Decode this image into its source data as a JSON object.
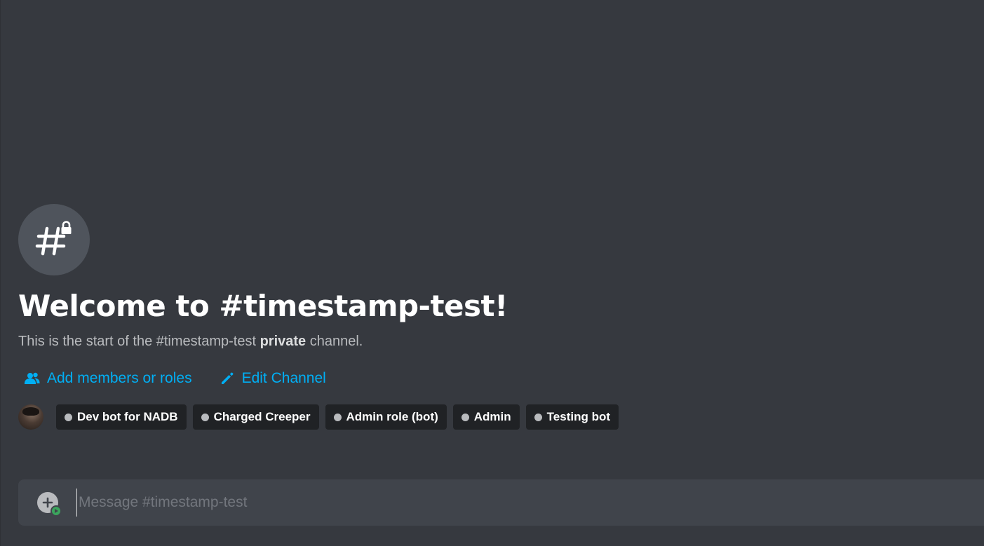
{
  "channel": {
    "name": "timestamp-test",
    "welcome_title": "Welcome to #timestamp-test!",
    "description_prefix": "This is the start of the #timestamp-test ",
    "description_strong": "private",
    "description_suffix": " channel.",
    "icon": "hashtag-lock-icon"
  },
  "actions": [
    {
      "label": "Add members or roles",
      "icon": "members-icon"
    },
    {
      "label": "Edit Channel",
      "icon": "pencil-icon"
    }
  ],
  "members": {
    "avatar": "user-avatar",
    "chips": [
      {
        "label": "Dev bot for NADB",
        "icon": "role-dot"
      },
      {
        "label": "Charged Creeper",
        "icon": "role-dot"
      },
      {
        "label": "Admin role (bot)",
        "icon": "role-dot"
      },
      {
        "label": "Admin",
        "icon": "role-dot"
      },
      {
        "label": "Testing bot",
        "icon": "role-dot"
      }
    ]
  },
  "composer": {
    "placeholder": "Message #timestamp-test",
    "value": "",
    "attach_icon": "plus-circle-icon",
    "badge_icon": "play-badge-icon"
  },
  "colors": {
    "background": "#36393f",
    "link": "#00aff4",
    "chip_bg": "#202225",
    "composer_bg": "#40444b",
    "badge": "#3ba55d"
  }
}
